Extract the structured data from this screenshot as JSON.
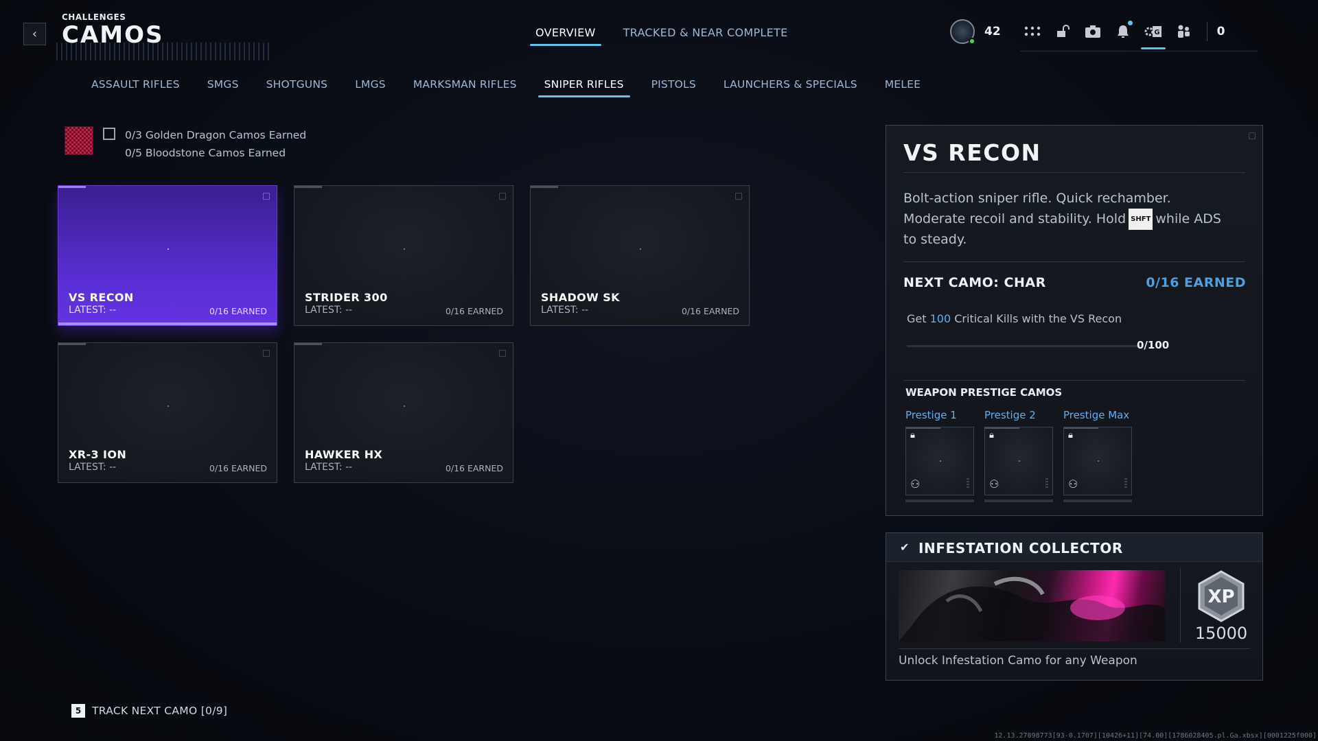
{
  "header": {
    "subtitle": "CHALLENGES",
    "title": "CAMOS",
    "tabs": [
      {
        "label": "OVERVIEW",
        "active": true
      },
      {
        "label": "TRACKED & NEAR COMPLETE",
        "active": false
      }
    ],
    "player_level": "42",
    "hud_count": "0",
    "icons": [
      "rank-emblem-icon",
      "apps-grid-icon",
      "lock-open-icon",
      "store-icon",
      "bell-icon",
      "settings-icon",
      "social-icon"
    ],
    "accent_color": "#5fc4ee"
  },
  "categories": [
    {
      "label": "ASSAULT RIFLES",
      "active": false
    },
    {
      "label": "SMGS",
      "active": false
    },
    {
      "label": "SHOTGUNS",
      "active": false
    },
    {
      "label": "LMGS",
      "active": false
    },
    {
      "label": "MARKSMAN RIFLES",
      "active": false
    },
    {
      "label": "SNIPER RIFLES",
      "active": true
    },
    {
      "label": "PISTOLS",
      "active": false
    },
    {
      "label": "LAUNCHERS & SPECIALS",
      "active": false
    },
    {
      "label": "MELEE",
      "active": false
    }
  ],
  "mastery": {
    "line1": "0/3 Golden Dragon Camos Earned",
    "line2": "0/5 Bloodstone Camos Earned"
  },
  "weapons": [
    {
      "name": "VS RECON",
      "latest": "LATEST: --",
      "earned": "0/16 EARNED",
      "selected": true
    },
    {
      "name": "STRIDER 300",
      "latest": "LATEST: --",
      "earned": "0/16 EARNED",
      "selected": false
    },
    {
      "name": "SHADOW SK",
      "latest": "LATEST: --",
      "earned": "0/16 EARNED",
      "selected": false
    },
    {
      "name": "XR-3 ION",
      "latest": "LATEST: --",
      "earned": "0/16 EARNED",
      "selected": false
    },
    {
      "name": "HAWKER HX",
      "latest": "LATEST: --",
      "earned": "0/16 EARNED",
      "selected": false
    }
  ],
  "detail": {
    "title": "VS RECON",
    "desc_part1": "Bolt-action sniper rifle.  Quick rechamber. Moderate recoil and stability.  Hold",
    "key": "SHFT",
    "desc_part2": "while ADS to steady.",
    "next_camo": "NEXT CAMO: CHAR",
    "next_earned": "0/16 EARNED",
    "challenge_pre": "Get",
    "challenge_num": "100",
    "challenge_post": "Critical Kills with the VS Recon",
    "challenge_progress": "0/100",
    "challenge_fraction": 0,
    "prestige_heading": "WEAPON PRESTIGE CAMOS",
    "prestige": [
      {
        "label": "Prestige 1",
        "locked": true
      },
      {
        "label": "Prestige 2",
        "locked": true
      },
      {
        "label": "Prestige Max",
        "locked": true
      }
    ]
  },
  "reward": {
    "title": "INFESTATION COLLECTOR",
    "xp_label": "XP",
    "xp_value": "15000",
    "desc": "Unlock Infestation Camo for any Weapon"
  },
  "footer": {
    "track_key": "5",
    "track_label": "TRACK NEXT CAMO [0/9]",
    "version": "12.13.27898773[93-0.1707][10426+11][74.00][1786028405.pl.Ga.xbsx][0001225f000]"
  },
  "selected_color": "#5a2fd6"
}
